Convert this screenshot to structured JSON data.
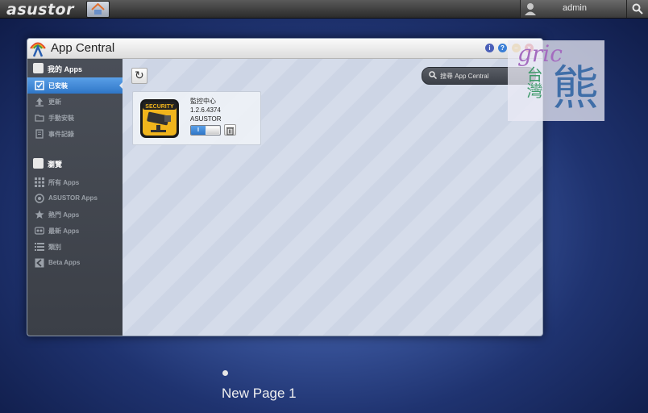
{
  "topbar": {
    "logo": "asustor",
    "user": "admin"
  },
  "window": {
    "title": "App Central",
    "buttons": [
      {
        "name": "info",
        "color": "#4a5fb8",
        "glyph": "i"
      },
      {
        "name": "help",
        "color": "#3b7fd6",
        "glyph": "?"
      },
      {
        "name": "minimize",
        "color": "#e8b33c",
        "glyph": "–"
      },
      {
        "name": "close",
        "color": "#d94c4c",
        "glyph": "×"
      }
    ]
  },
  "sidebar": {
    "my_apps_label": "我的 Apps",
    "my_apps_items": [
      {
        "label": "已安裝",
        "active": true
      },
      {
        "label": "更新",
        "active": false
      },
      {
        "label": "手動安裝",
        "active": false
      },
      {
        "label": "事件記錄",
        "active": false
      }
    ],
    "browse_label": "瀏覽",
    "browse_items": [
      {
        "label": "所有 Apps"
      },
      {
        "label": "ASUSTOR Apps"
      },
      {
        "label": "熱門 Apps"
      },
      {
        "label": "最新 Apps"
      },
      {
        "label": "類別"
      },
      {
        "label": "Beta Apps"
      }
    ]
  },
  "search": {
    "placeholder": "搜尋 App Central"
  },
  "app_card": {
    "name": "監控中心",
    "version": "1.2.6.4374",
    "developer": "ASUSTOR",
    "thumb_label": "SECURITY",
    "toggle_label": "I",
    "enabled": true
  },
  "watermark": {
    "text": "gric",
    "tw": "台灣",
    "bear": "熊"
  },
  "desktop": {
    "page_label": "New Page 1"
  }
}
